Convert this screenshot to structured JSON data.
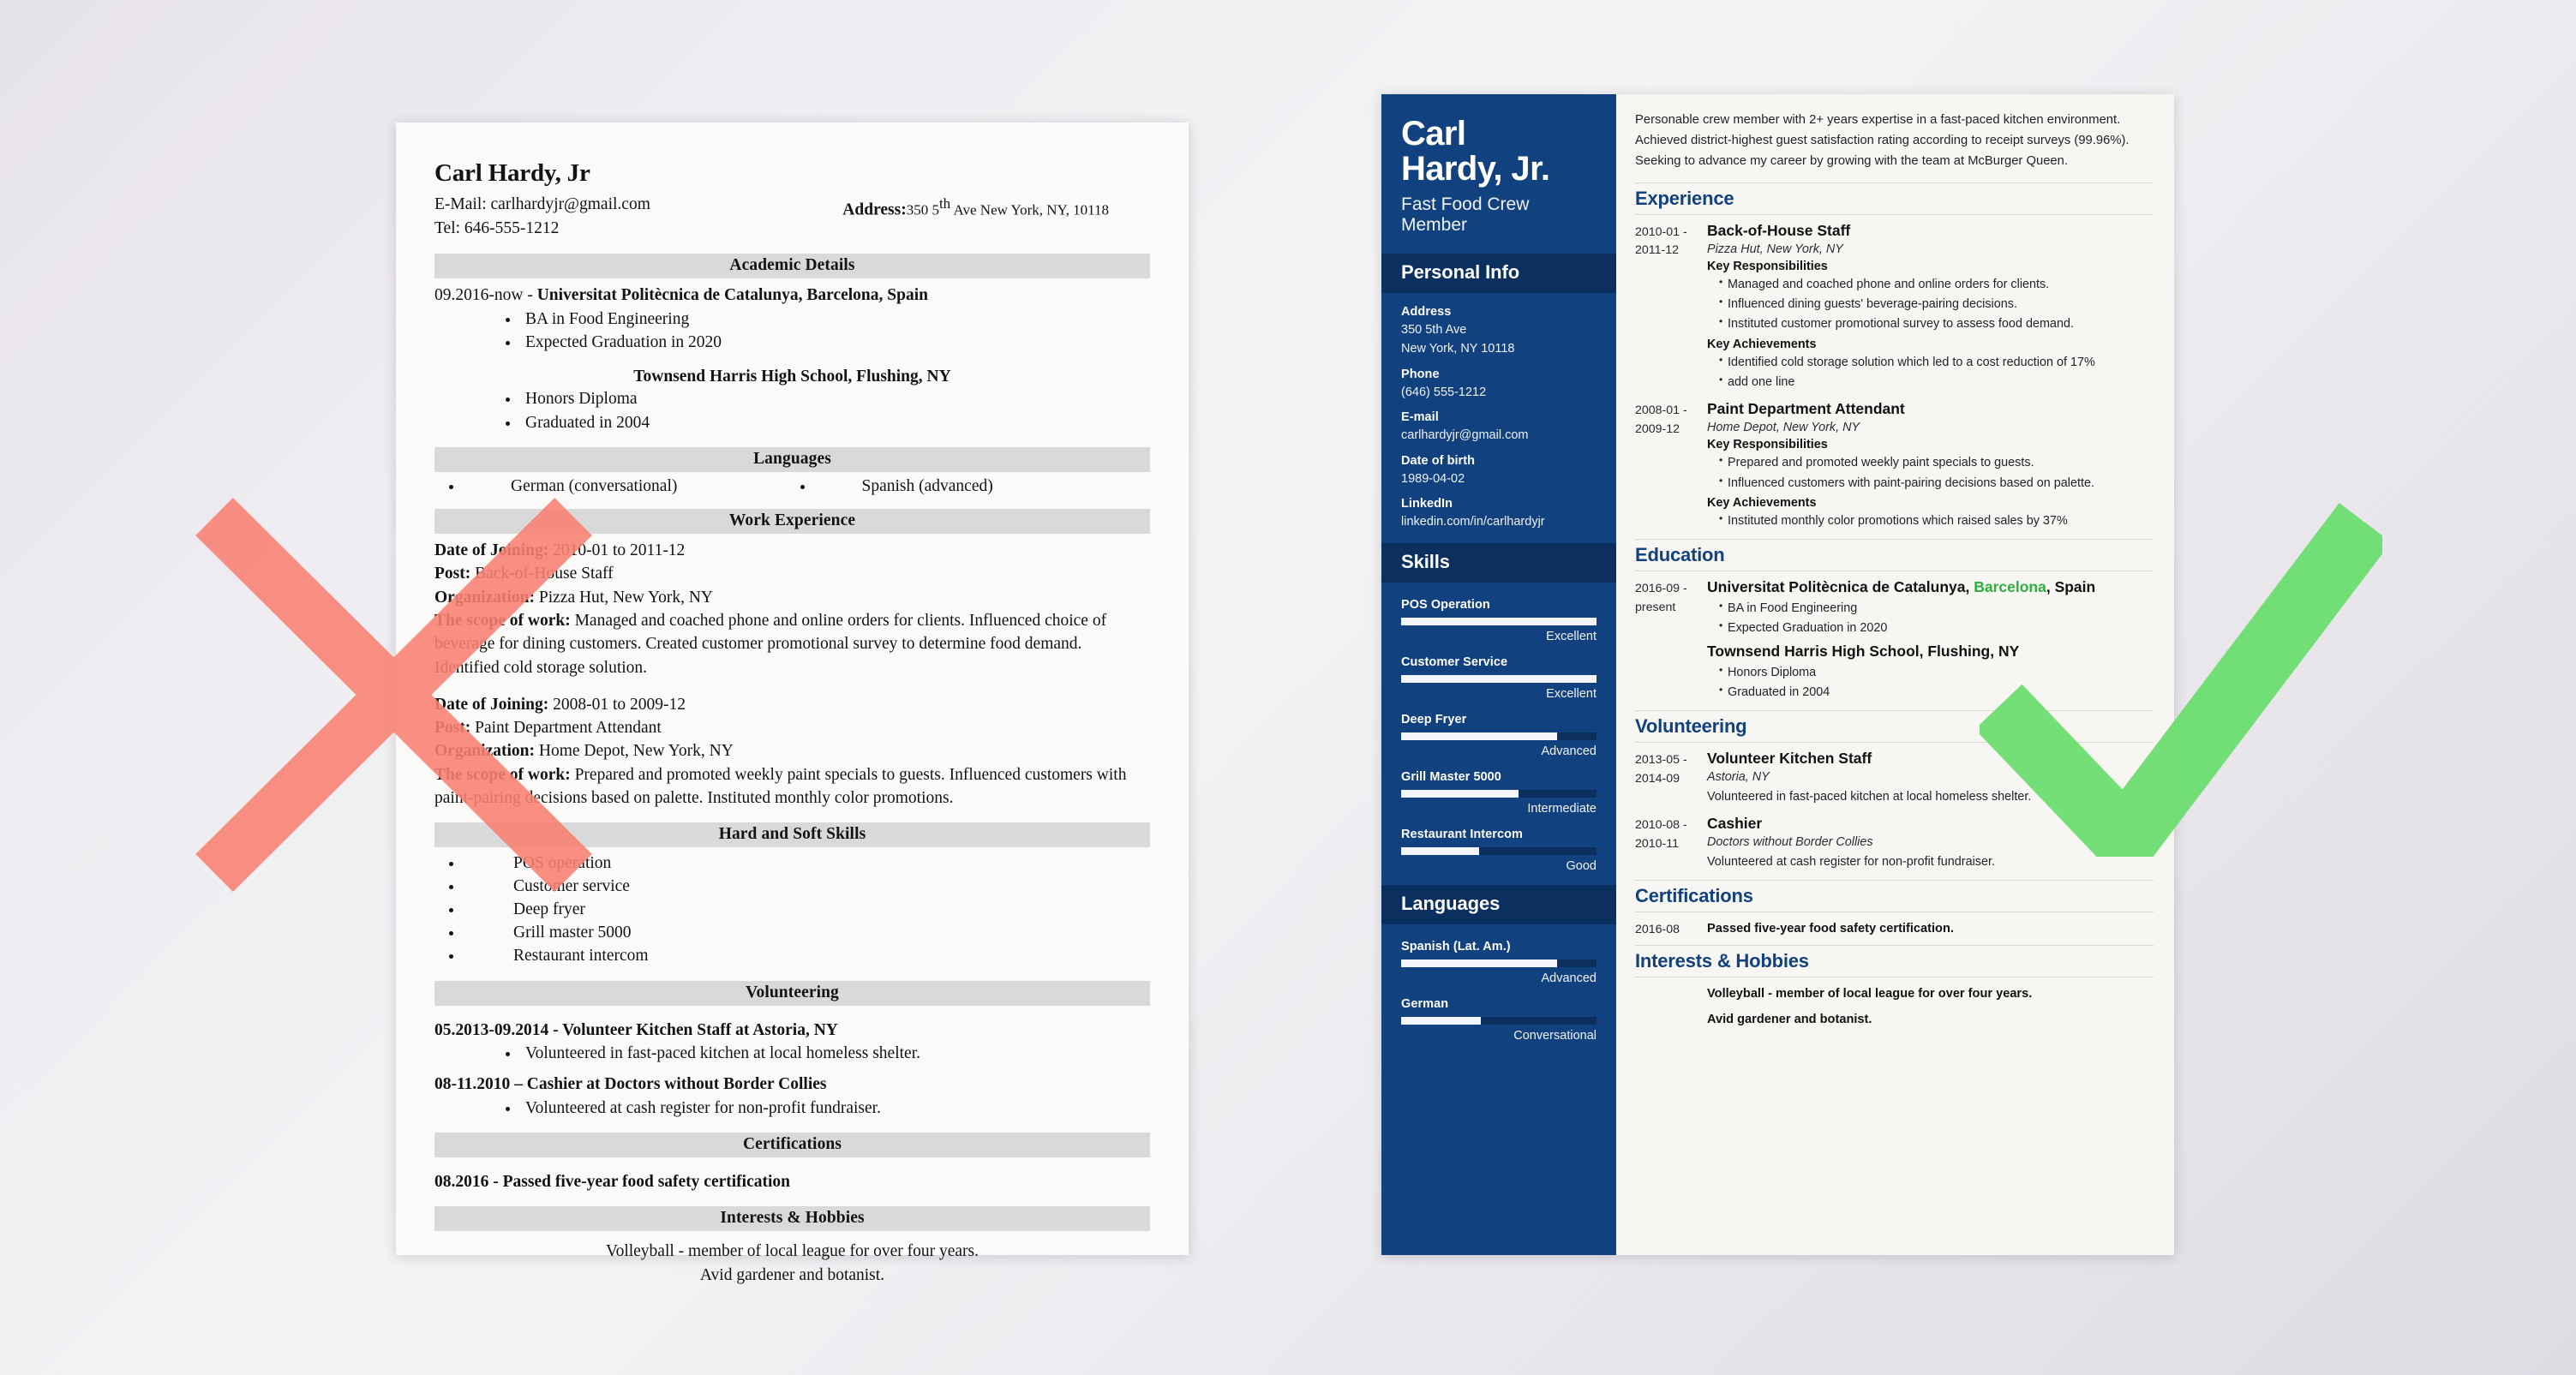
{
  "colors": {
    "page_bg": "#eceaf0",
    "bad_paper": "#fbfaf8",
    "bad_section_bar": "#d9d9d9",
    "good_paper": "#f7f6f2",
    "sidebar_blue": "#11417e",
    "sidebar_dark_blue": "#0b2f5e",
    "accent_heading": "#11417e",
    "mark_x_red": "#f98d7e",
    "mark_check_green": "#6ade6e",
    "highlight_green": "#2cae3f"
  },
  "bad_resume": {
    "name": "Carl Hardy, Jr",
    "email_line": "E-Mail: carlhardyjr@gmail.com",
    "tel_line": "Tel: 646-555-1212",
    "address_label": "Address:",
    "address_value_pre": "350 5",
    "address_value_sup": "th",
    "address_value_post": " Ave New York, NY, 10118",
    "sections": {
      "academic": "Academic Details",
      "languages": "Languages",
      "work": "Work Experience",
      "skills": "Hard and Soft Skills",
      "volunteering": "Volunteering",
      "certifications": "Certifications",
      "interests": "Interests & Hobbies"
    },
    "academic": {
      "entry1_head": "09.2016-now - Universitat Politècnica de Catalunya, Barcelona, Spain",
      "entry1_date": "09.2016-now - ",
      "entry1_school": "Universitat Politècnica de Catalunya, Barcelona, Spain",
      "entry1_bullets": [
        "BA in Food Engineering",
        "Expected Graduation in 2020"
      ],
      "entry2_school": "Townsend Harris High School, Flushing, NY",
      "entry2_bullets": [
        "Honors Diploma",
        "Graduated in 2004"
      ]
    },
    "languages": [
      "German (conversational)",
      "Spanish (advanced)"
    ],
    "work": [
      {
        "date_label": "Date of Joining:",
        "date_value": " 2010-01 to 2011-12",
        "post_label": "Post:",
        "post_value": " Back-of-House Staff",
        "org_label": "Organization:",
        "org_value": " Pizza Hut, New York, NY",
        "scope_label": "The scope of work:",
        "scope_value": " Managed and coached phone and online orders for clients. Influenced choice of beverage for dining customers. Created customer promotional survey to determine food demand. Identified cold storage solution."
      },
      {
        "date_label": "Date of Joining:",
        "date_value": " 2008-01 to 2009-12",
        "post_label": "Post:",
        "post_value": " Paint Department Attendant",
        "org_label": "Organization:",
        "org_value": " Home Depot, New York, NY",
        "scope_label": "The scope of work:",
        "scope_value": " Prepared and promoted weekly paint specials to guests. Influenced customers with paint-pairing decisions based on palette. Instituted monthly color promotions."
      }
    ],
    "skills": [
      "POS operation",
      "Customer service",
      "Deep fryer",
      "Grill master 5000",
      "Restaurant intercom"
    ],
    "volunteering": [
      {
        "head": "05.2013-09.2014 - Volunteer Kitchen Staff at Astoria, NY",
        "bullet": "Volunteered in fast-paced kitchen at local homeless shelter."
      },
      {
        "head": "08-11.2010 – Cashier at Doctors without Border Collies",
        "bullet": "Volunteered at cash register for non-profit fundraiser."
      }
    ],
    "certifications": "08.2016 - Passed five-year food safety certification",
    "interests": [
      "Volleyball - member of local league for over four years.",
      "Avid gardener and botanist."
    ]
  },
  "good_resume": {
    "sidebar": {
      "name_line1": "Carl",
      "name_line2": "Hardy, Jr.",
      "role_line1": "Fast Food Crew",
      "role_line2": "Member",
      "personal_info_heading": "Personal Info",
      "fields": [
        {
          "label": "Address",
          "value_line1": "350 5th Ave",
          "value_line2": "New York, NY 10118"
        },
        {
          "label": "Phone",
          "value_line1": "(646) 555-1212",
          "value_line2": ""
        },
        {
          "label": "E-mail",
          "value_line1": "carlhardyjr@gmail.com",
          "value_line2": ""
        },
        {
          "label": "Date of birth",
          "value_line1": "1989-04-02",
          "value_line2": ""
        },
        {
          "label": "LinkedIn",
          "value_line1": "linkedin.com/in/carlhardyjr",
          "value_line2": ""
        }
      ],
      "skills_heading": "Skills",
      "skills": [
        {
          "name": "POS Operation",
          "level": "Excellent",
          "percent": 100
        },
        {
          "name": "Customer Service",
          "level": "Excellent",
          "percent": 100
        },
        {
          "name": "Deep Fryer",
          "level": "Advanced",
          "percent": 80
        },
        {
          "name": "Grill Master 5000",
          "level": "Intermediate",
          "percent": 60
        },
        {
          "name": "Restaurant Intercom",
          "level": "Good",
          "percent": 40
        }
      ],
      "languages_heading": "Languages",
      "languages": [
        {
          "name": "Spanish (Lat. Am.)",
          "level": "Advanced",
          "percent": 80
        },
        {
          "name": "German",
          "level": "Conversational",
          "percent": 41
        }
      ]
    },
    "main": {
      "summary": "Personable crew member with 2+ years expertise in a fast-paced kitchen environment. Achieved district-highest guest satisfaction rating according to receipt surveys (99.96%). Seeking to advance my career by growing with the team at McBurger Queen.",
      "experience_heading": "Experience",
      "experience": [
        {
          "date_line1": "2010-01 -",
          "date_line2": "2011-12",
          "title": "Back-of-House Staff",
          "company": "Pizza Hut, New York, NY",
          "responsibilities_heading": "Key Responsibilities",
          "responsibilities": [
            "Managed and coached phone and online orders for clients.",
            "Influenced dining guests' beverage-pairing decisions.",
            "Instituted customer promotional survey to assess food demand."
          ],
          "achievements_heading": "Key Achievements",
          "achievements": [
            "Identified cold storage solution which led to a cost reduction of 17%",
            "add one line"
          ]
        },
        {
          "date_line1": "2008-01 -",
          "date_line2": "2009-12",
          "title": "Paint Department Attendant",
          "company": "Home Depot, New York, NY",
          "responsibilities_heading": "Key Responsibilities",
          "responsibilities": [
            "Prepared and promoted weekly paint specials to guests.",
            "Influenced customers with paint-pairing decisions based on palette."
          ],
          "achievements_heading": "Key Achievements",
          "achievements": [
            "Instituted monthly color promotions which raised sales by 37%"
          ]
        }
      ],
      "education_heading": "Education",
      "education": [
        {
          "date_line1": "2016-09 -",
          "date_line2": "present",
          "title_pre": "Universitat Politècnica de Catalunya, ",
          "title_hl": "Barcelona",
          "title_post": ", Spain",
          "bullets": [
            "BA in Food Engineering",
            "Expected Graduation in 2020"
          ]
        },
        {
          "date_line1": "",
          "date_line2": "",
          "title_pre": "Townsend Harris High School, Flushing, NY",
          "title_hl": "",
          "title_post": "",
          "bullets": [
            "Honors Diploma",
            "Graduated in 2004"
          ]
        }
      ],
      "volunteering_heading": "Volunteering",
      "volunteering": [
        {
          "date_line1": "2013-05 -",
          "date_line2": "2014-09",
          "title": "Volunteer Kitchen Staff",
          "company": "Astoria, NY",
          "note": "Volunteered in fast-paced kitchen at local homeless shelter."
        },
        {
          "date_line1": "2010-08 -",
          "date_line2": "2010-11",
          "title": "Cashier",
          "company": "Doctors without Border Collies",
          "note": "Volunteered at cash register for non-profit fundraiser."
        }
      ],
      "certifications_heading": "Certifications",
      "certifications": [
        {
          "date": "2016-08",
          "text": "Passed five-year food safety certification."
        }
      ],
      "interests_heading": "Interests & Hobbies",
      "interests": [
        "Volleyball - member of local league for over four years.",
        "Avid gardener and botanist."
      ]
    }
  },
  "marks": {
    "reject_icon": "x-mark-icon",
    "approve_icon": "check-mark-icon"
  }
}
